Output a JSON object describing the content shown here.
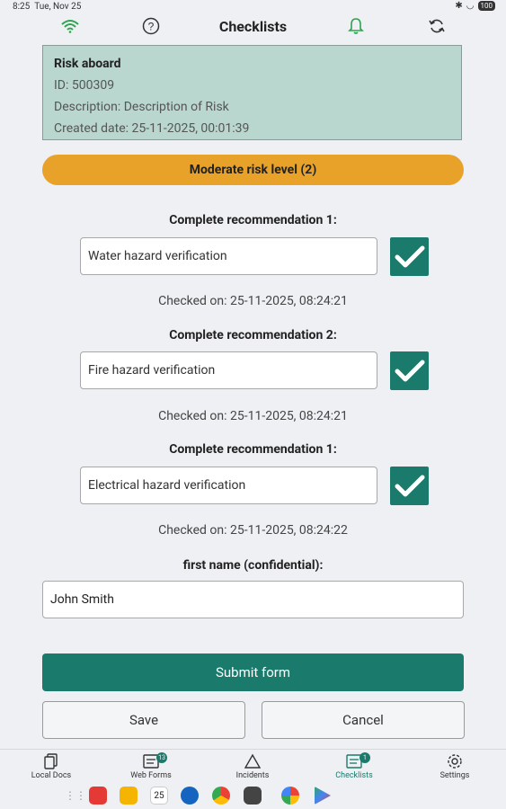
{
  "status_bar": {
    "time": "8:25",
    "date": "Tue, Nov 25",
    "battery": "100"
  },
  "header": {
    "title": "Checklists"
  },
  "risk": {
    "heading": "Risk aboard",
    "id": "ID: 500309",
    "description": "Description: Description of Risk",
    "created": "Created date: 25-11-2025, 00:01:39"
  },
  "risk_level": "Moderate risk level (2)",
  "recommendations": [
    {
      "label": "Complete recommendation 1:",
      "value": "Water hazard verification",
      "checked_on": "Checked on: 25-11-2025, 08:24:21"
    },
    {
      "label": "Complete recommendation 2:",
      "value": "Fire hazard verification",
      "checked_on": "Checked on: 25-11-2025, 08:24:21"
    },
    {
      "label": "Complete recommendation 1:",
      "value": "Electrical hazard verification",
      "checked_on": "Checked on: 25-11-2025, 08:24:22"
    }
  ],
  "name_field": {
    "label": "first name (confidential):",
    "value": "John Smith"
  },
  "buttons": {
    "submit": "Submit form",
    "save": "Save",
    "cancel": "Cancel"
  },
  "nav": {
    "local_docs": "Local Docs",
    "web_forms": "Web Forms",
    "web_forms_badge": "13",
    "incidents": "Incidents",
    "checklists": "Checklists",
    "checklists_badge": "1",
    "settings": "Settings"
  },
  "taskbar": {
    "calendar_day": "25"
  },
  "colors": {
    "accent": "#1a7a6c",
    "risk_card": "#b9d7cf",
    "risk_level": "#e8a22a",
    "background": "#eef0f4"
  }
}
